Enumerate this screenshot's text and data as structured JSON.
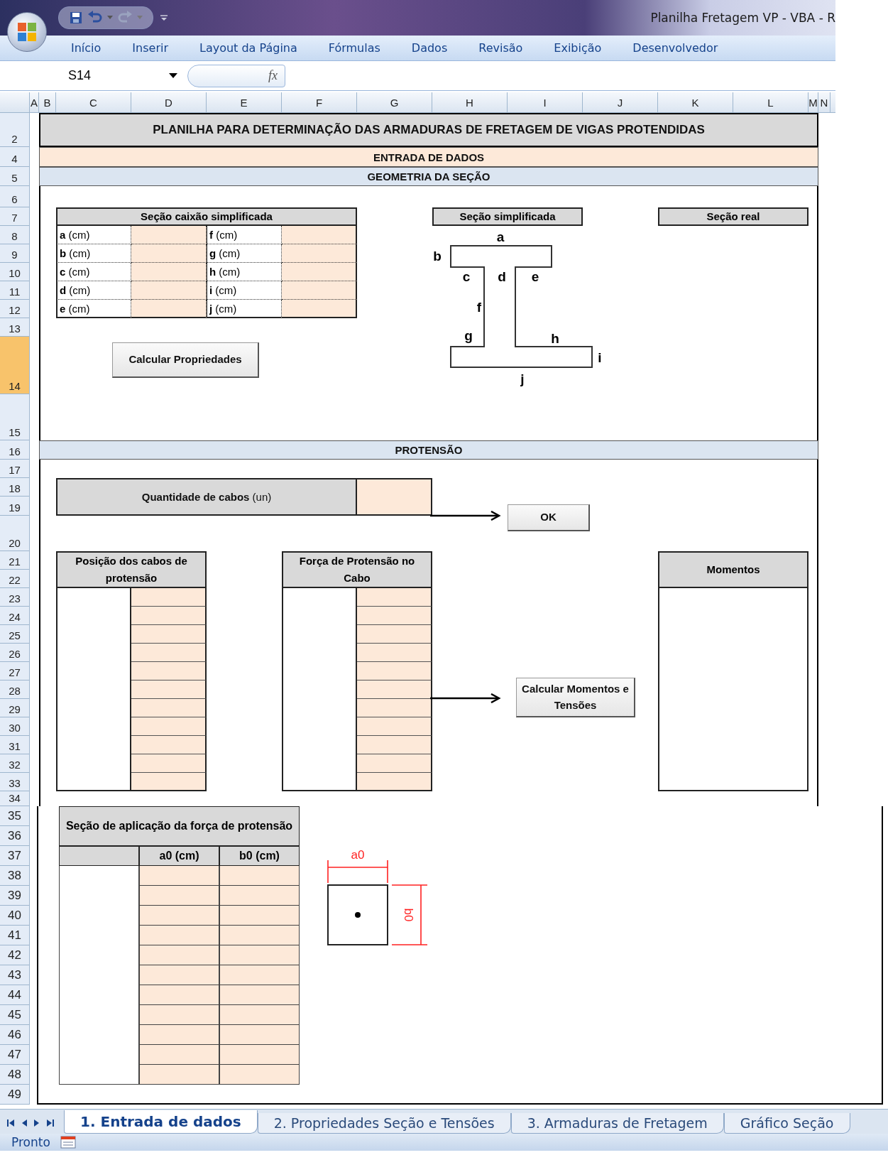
{
  "window": {
    "title": "Planilha Fretagem VP - VBA - R"
  },
  "ribbon_tabs": [
    "Início",
    "Inserir",
    "Layout da Página",
    "Fórmulas",
    "Dados",
    "Revisão",
    "Exibição",
    "Desenvolvedor"
  ],
  "formula_bar": {
    "name_box": "S14",
    "fx_label": "fx"
  },
  "column_headers": [
    "A",
    "B",
    "C",
    "D",
    "E",
    "F",
    "G",
    "H",
    "I",
    "J",
    "K",
    "L",
    "M",
    "N"
  ],
  "row_numbers_upper": [
    {
      "label": "2",
      "selected": false
    },
    {
      "label": "4",
      "selected": false
    },
    {
      "label": "5",
      "selected": false
    },
    {
      "label": "6",
      "selected": false
    },
    {
      "label": "7",
      "selected": false
    },
    {
      "label": "8",
      "selected": false
    },
    {
      "label": "9",
      "selected": false
    },
    {
      "label": "10",
      "selected": false
    },
    {
      "label": "11",
      "selected": false
    },
    {
      "label": "12",
      "selected": false
    },
    {
      "label": "13",
      "selected": false
    },
    {
      "label": "14",
      "selected": true
    },
    {
      "label": "15",
      "selected": false
    },
    {
      "label": "16",
      "selected": false
    },
    {
      "label": "17",
      "selected": false
    },
    {
      "label": "18",
      "selected": false
    },
    {
      "label": "19",
      "selected": false
    },
    {
      "label": "20",
      "selected": false
    },
    {
      "label": "21",
      "selected": false
    },
    {
      "label": "22",
      "selected": false
    },
    {
      "label": "23",
      "selected": false
    },
    {
      "label": "24",
      "selected": false
    },
    {
      "label": "25",
      "selected": false
    },
    {
      "label": "26",
      "selected": false
    },
    {
      "label": "27",
      "selected": false
    },
    {
      "label": "28",
      "selected": false
    },
    {
      "label": "29",
      "selected": false
    },
    {
      "label": "30",
      "selected": false
    },
    {
      "label": "31",
      "selected": false
    },
    {
      "label": "32",
      "selected": false
    },
    {
      "label": "33",
      "selected": false
    },
    {
      "label": "34",
      "selected": false
    }
  ],
  "row_numbers_lower": [
    "35",
    "36",
    "37",
    "38",
    "39",
    "40",
    "41",
    "42",
    "43",
    "44",
    "45",
    "46",
    "47",
    "48",
    "49"
  ],
  "sheet": {
    "title": "PLANILHA PARA DETERMINAÇÃO DAS ARMADURAS DE FRETAGEM DE VIGAS PROTENDIDAS",
    "entry_band": "ENTRADA DE DADOS",
    "geometry_band": "GEOMETRIA DA SEÇÃO",
    "section_table": {
      "title": "Seção caixão simplificada",
      "rows": [
        {
          "left": "**a** (cm)",
          "right": "**f** (cm)"
        },
        {
          "left": "**b** (cm)",
          "right": "**g** (cm)"
        },
        {
          "left": "**c** (cm)",
          "right": "**h** (cm)"
        },
        {
          "left": "**d** (cm)",
          "right": "**i** (cm)"
        },
        {
          "left": "**e** (cm)",
          "right": "**j** (cm)"
        }
      ]
    },
    "simplified_header": "Seção simplificada",
    "real_header": "Seção real",
    "beam_labels": [
      "a",
      "b",
      "c",
      "d",
      "e",
      "f",
      "g",
      "h",
      "i",
      "j"
    ],
    "properties_button": "Calcular Propriedades",
    "prestress_band": "PROTENSÃO",
    "cable_count_label": "**Quantidade de cabos** (un)",
    "ok_button": "OK",
    "position_title": "Posição dos cabos de protensão",
    "force_title": "Força de Protensão no Cabo",
    "moments_title": "Momentos",
    "moments_button": "Calcular Momentos e Tensões",
    "application_table": {
      "title": "Seção de aplicação da força de protensão",
      "columns": [
        "a0 (cm)",
        "b0 (cm)"
      ]
    },
    "application_drawing": {
      "width_label": "a0",
      "height_label": "b0"
    }
  },
  "sheet_tabs": [
    {
      "label": "1. Entrada de dados",
      "selected": true
    },
    {
      "label": "2. Propriedades Seção e Tensões",
      "selected": false
    },
    {
      "label": "3. Armaduras de Fretagem",
      "selected": false
    },
    {
      "label": "Gráfico Seção",
      "selected": false
    }
  ],
  "status_bar": {
    "text": "Pronto"
  }
}
